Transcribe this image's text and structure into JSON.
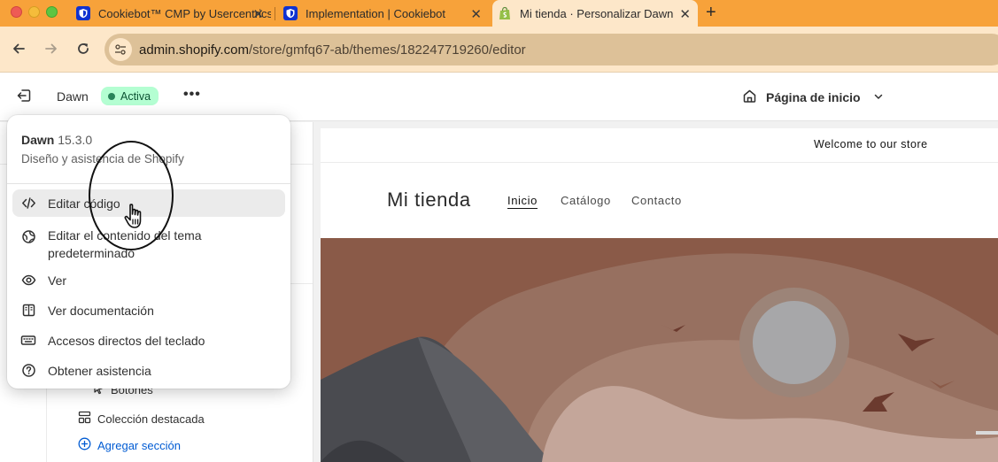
{
  "browser": {
    "tabs": [
      {
        "title": "Cookiebot™ CMP by Usercentrics",
        "icon": "cookiebot-shield-icon"
      },
      {
        "title": "Implementation | Cookiebot",
        "icon": "cookiebot-shield-icon"
      },
      {
        "title": "Mi tienda · Personalizar Dawn",
        "icon": "shopify-bag-icon",
        "active": true
      }
    ],
    "close_glyph": "✕",
    "new_tab_glyph": "+",
    "url_host": "admin.shopify.com",
    "url_path": "/store/gmfq67-ab/themes/182247719260/editor"
  },
  "header": {
    "theme_name": "Dawn",
    "status_badge": "Activa",
    "more_glyph": "•••",
    "page_selector": "Página de inicio"
  },
  "sidebar": {
    "items": [
      {
        "label": "Botones",
        "icon": "cursor-icon"
      },
      {
        "label": "Colección destacada",
        "icon": "collection-grid-icon"
      },
      {
        "label": "Agregar sección",
        "icon": "plus-circle-icon"
      }
    ]
  },
  "menu": {
    "theme_name": "Dawn",
    "theme_version": "15.3.0",
    "subtitle": "Diseño y asistencia de Shopify",
    "items": [
      {
        "label": "Editar código",
        "icon": "code-icon",
        "hovered": true
      },
      {
        "label": "Editar el contenido del tema predeterminado",
        "icon": "globe-icon"
      },
      {
        "label": "Ver",
        "icon": "eye-icon"
      },
      {
        "label": "Ver documentación",
        "icon": "book-icon"
      },
      {
        "label": "Accesos directos del teclado",
        "icon": "keyboard-icon"
      },
      {
        "label": "Obtener asistencia",
        "icon": "question-circle-icon"
      }
    ]
  },
  "preview": {
    "announcement": "Welcome to our store",
    "store_title": "Mi tienda",
    "nav": [
      "Inicio",
      "Catálogo",
      "Contacto"
    ],
    "colors": {
      "hero_bg": "#8a5a48",
      "sun": "#a7a7a9",
      "mountain": "#4a4b50"
    }
  },
  "colors": {
    "tabbar": "#f7a23a",
    "toolbar": "#fde7c9",
    "badge_bg": "#b4fed2",
    "badge_dot": "#29845a",
    "link_blue": "#005bd3"
  }
}
